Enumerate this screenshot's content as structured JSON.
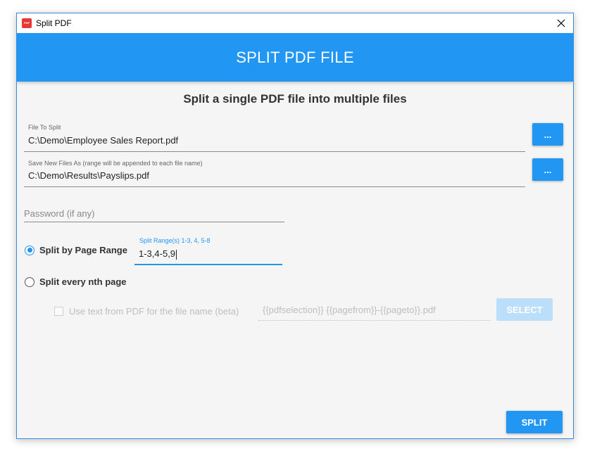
{
  "window": {
    "title": "Split PDF",
    "icon_text": "PDF"
  },
  "header": {
    "title": "SPLIT PDF FILE"
  },
  "subtitle": "Split a single PDF file into multiple files",
  "file_to_split": {
    "label": "File To Split",
    "value": "C:\\Demo\\Employee Sales Report.pdf",
    "browse_label": "..."
  },
  "save_as": {
    "label": "Save New Files As (range will be appended to each file name)",
    "value": "C:\\Demo\\Results\\Payslips.pdf",
    "browse_label": "..."
  },
  "password": {
    "placeholder": "Password (if any)",
    "value": ""
  },
  "mode": {
    "selected": "page_range",
    "page_range_label": "Split by Page Range",
    "nth_page_label": "Split every nth page"
  },
  "split_range": {
    "label": "Split Range(s) 1-3, 4, 5-8",
    "value": "1-3,4-5,9"
  },
  "filename_option": {
    "checked": false,
    "label": "Use text from PDF for the file name (beta)",
    "pattern": "{{pdfselection}} {{pagefrom}}-{{pageto}}.pdf",
    "select_label": "SELECT"
  },
  "actions": {
    "split_label": "SPLIT"
  },
  "colors": {
    "accent": "#2196f3",
    "disabled_button": "#bbdefb",
    "app_icon": "#e53935"
  },
  "icons": {
    "app": "pdf-app-icon",
    "close": "close-icon"
  }
}
